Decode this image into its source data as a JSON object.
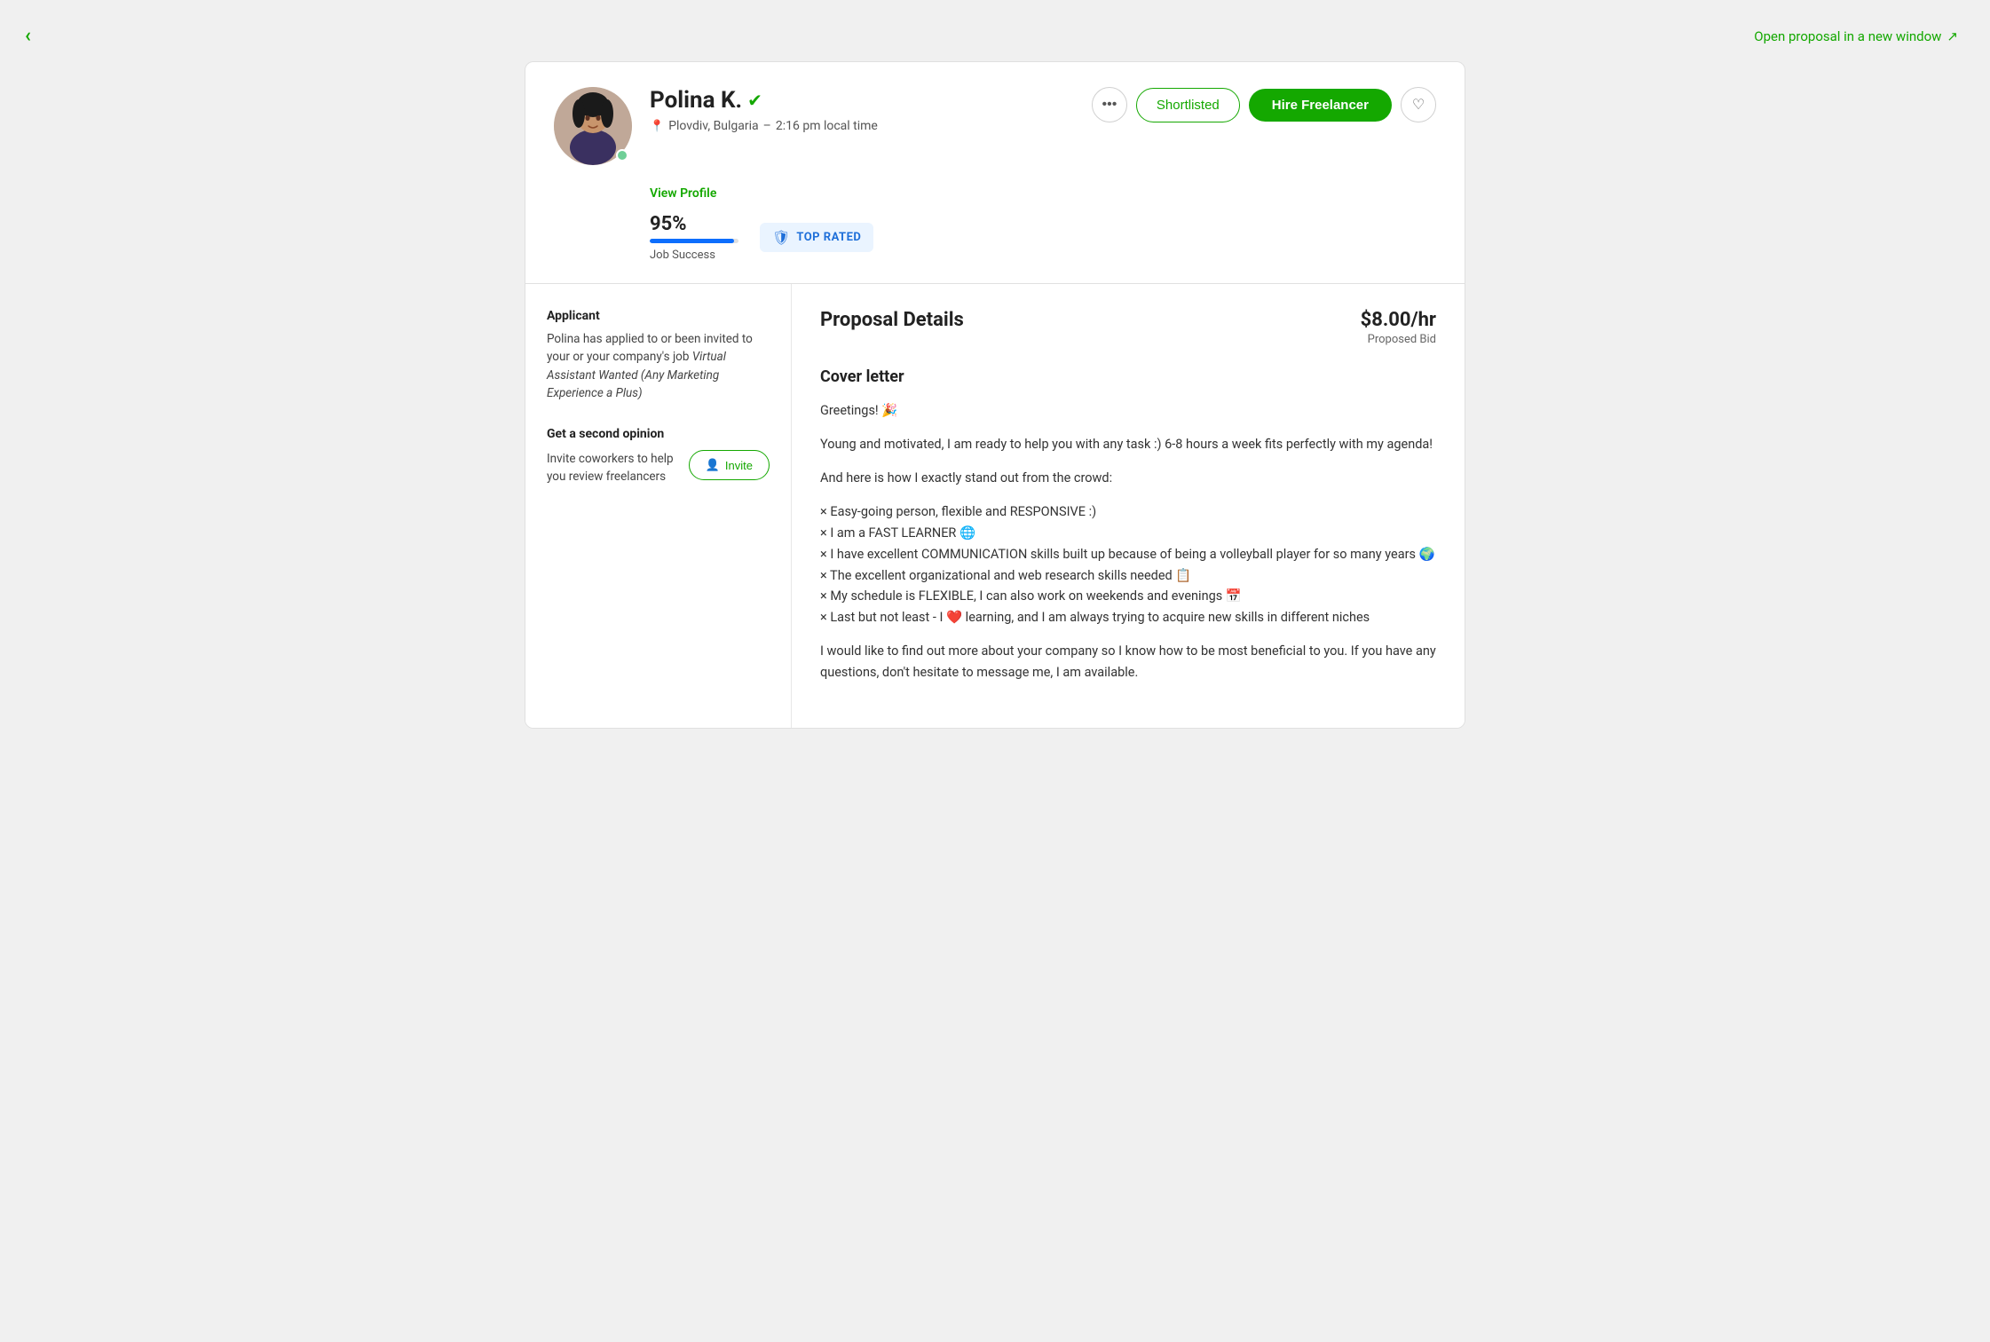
{
  "topbar": {
    "back_label": "‹",
    "open_proposal_label": "Open proposal in a new window",
    "open_icon": "⬡"
  },
  "profile": {
    "name": "Polina K.",
    "verified": true,
    "location": "Plovdiv, Bulgaria",
    "local_time": "2:16 pm local time",
    "job_success_pct": "95%",
    "job_success_label": "Job Success",
    "top_rated_label": "TOP RATED",
    "view_profile_label": "View Profile",
    "progress_width": "95",
    "online": true
  },
  "actions": {
    "more_icon": "•••",
    "shortlisted_label": "Shortlisted",
    "hire_label": "Hire Freelancer",
    "heart_icon": "♡"
  },
  "sidebar": {
    "applicant_title": "Applicant",
    "applicant_text_plain": "Polina has applied to or been invited to your or your company's job ",
    "applicant_job_title": "Virtual Assistant Wanted (Any Marketing Experience a Plus)",
    "second_opinion_title": "Get a second opinion",
    "second_opinion_desc": "Invite coworkers to help you review freelancers",
    "invite_label": "Invite",
    "invite_icon": "👤"
  },
  "proposal": {
    "title": "Proposal Details",
    "bid_amount": "$8.00/hr",
    "bid_label": "Proposed Bid",
    "cover_letter_title": "Cover letter",
    "greeting": "Greetings! 🎉",
    "para1": "Young and motivated, I am ready to help you with any task :) 6-8 hours a week fits perfectly with my agenda!",
    "para2": "And here is how I exactly stand out from the crowd:",
    "bullet1": "× Easy-going person, flexible and RESPONSIVE :)",
    "bullet2": "× I am a FAST LEARNER 🌐",
    "bullet3": "× I have excellent COMMUNICATION skills built up because of being a volleyball player for so many years 🌍",
    "bullet4": "× The excellent organizational and web research skills needed 📋",
    "bullet5": "× My schedule is FLEXIBLE, I can also work on weekends and evenings 📅",
    "bullet6": "× Last but not least - I ❤️ learning, and I am always trying to acquire new skills in different niches",
    "para3": "I would like to find out more about your company so I know how to be most beneficial to you. If you have any questions, don't hesitate to message me, I am available."
  }
}
